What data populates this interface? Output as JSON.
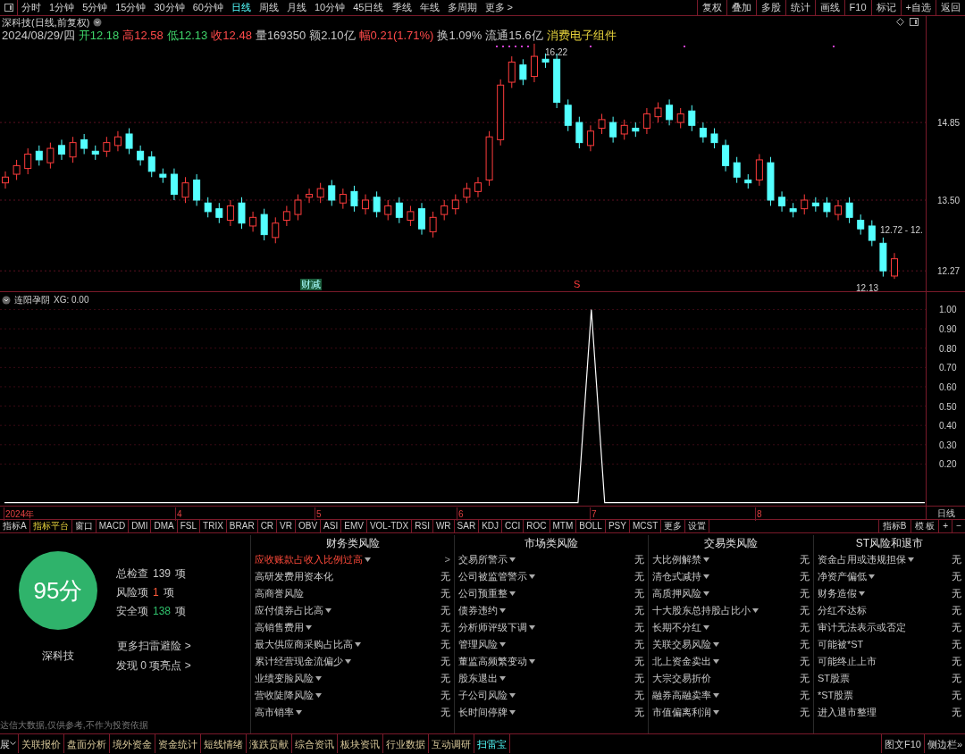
{
  "toolbar": {
    "periods": [
      {
        "label": "分时",
        "selected": false
      },
      {
        "label": "1分钟",
        "selected": false
      },
      {
        "label": "5分钟",
        "selected": false
      },
      {
        "label": "15分钟",
        "selected": false
      },
      {
        "label": "30分钟",
        "selected": false
      },
      {
        "label": "60分钟",
        "selected": false
      },
      {
        "label": "日线",
        "selected": true
      },
      {
        "label": "周线",
        "selected": false
      },
      {
        "label": "月线",
        "selected": false
      },
      {
        "label": "10分钟",
        "selected": false
      },
      {
        "label": "45日线",
        "selected": false
      },
      {
        "label": "季线",
        "selected": false
      },
      {
        "label": "年线",
        "selected": false
      },
      {
        "label": "多周期",
        "selected": false
      },
      {
        "label": "更多 >",
        "selected": false
      }
    ],
    "actions": [
      "复权",
      "叠加",
      "多股",
      "统计",
      "画线",
      "F10",
      "标记",
      "+自选",
      "返回"
    ]
  },
  "quote": {
    "title": "深科技(日线,前复权)",
    "date": "2024/08/29/四",
    "fields": [
      {
        "text": "开12.18",
        "color": "#3fd46a"
      },
      {
        "text": "高12.58",
        "color": "#ff4a4a"
      },
      {
        "text": "低12.13",
        "color": "#3fd46a"
      },
      {
        "text": "收12.48",
        "color": "#ff4a4a"
      },
      {
        "text": "量169350",
        "color": "#c8c8c8"
      },
      {
        "text": "额2.10亿",
        "color": "#c8c8c8"
      },
      {
        "text": "幅0.21(1.71%)",
        "color": "#ff4a4a"
      },
      {
        "text": "换1.09%",
        "color": "#c8c8c8"
      },
      {
        "text": "流通15.6亿",
        "color": "#c8c8c8"
      },
      {
        "text": "消费电子组件",
        "color": "#e6d23c"
      }
    ]
  },
  "price_chart": {
    "high_label": "16.22",
    "range_label": "12.72 - 12.",
    "low_label": "12.13",
    "markers": [
      {
        "text": "财减",
        "kind": "box"
      },
      {
        "text": "S",
        "kind": "signal"
      }
    ],
    "chart_data": {
      "type": "candlestick",
      "grid": true,
      "ylim": [
        11.9,
        16.7
      ],
      "yticks": [
        {
          "value": 14.85,
          "label": "14.85"
        },
        {
          "value": 13.5,
          "label": "13.50"
        },
        {
          "value": 12.27,
          "label": "12.27"
        }
      ],
      "ohlc": [
        [
          13.8,
          14.0,
          13.7,
          13.9
        ],
        [
          13.95,
          14.2,
          13.85,
          14.1
        ],
        [
          14.05,
          14.4,
          13.95,
          14.3
        ],
        [
          14.35,
          14.45,
          14.1,
          14.2
        ],
        [
          14.15,
          14.5,
          14.05,
          14.4
        ],
        [
          14.45,
          14.55,
          14.2,
          14.3
        ],
        [
          14.25,
          14.6,
          14.15,
          14.5
        ],
        [
          14.55,
          14.65,
          14.3,
          14.4
        ],
        [
          14.35,
          14.45,
          14.2,
          14.3
        ],
        [
          14.35,
          14.6,
          14.25,
          14.5
        ],
        [
          14.45,
          14.7,
          14.35,
          14.6
        ],
        [
          14.65,
          14.75,
          14.3,
          14.4
        ],
        [
          14.35,
          14.45,
          14.1,
          14.2
        ],
        [
          14.25,
          14.35,
          13.9,
          14.0
        ],
        [
          13.95,
          14.05,
          13.8,
          13.9
        ],
        [
          13.95,
          14.05,
          13.5,
          13.6
        ],
        [
          13.55,
          13.9,
          13.45,
          13.8
        ],
        [
          13.85,
          13.95,
          13.4,
          13.5
        ],
        [
          13.45,
          13.55,
          13.2,
          13.3
        ],
        [
          13.35,
          13.45,
          13.1,
          13.2
        ],
        [
          13.15,
          13.5,
          13.05,
          13.4
        ],
        [
          13.45,
          13.55,
          13.0,
          13.1
        ],
        [
          13.05,
          13.3,
          12.95,
          13.2
        ],
        [
          13.25,
          13.35,
          12.8,
          12.9
        ],
        [
          12.85,
          13.2,
          12.75,
          13.1
        ],
        [
          13.15,
          13.4,
          13.05,
          13.3
        ],
        [
          13.25,
          13.6,
          13.15,
          13.5
        ],
        [
          13.55,
          13.7,
          13.45,
          13.6
        ],
        [
          13.55,
          13.8,
          13.45,
          13.7
        ],
        [
          13.75,
          13.85,
          13.4,
          13.5
        ],
        [
          13.45,
          13.7,
          13.35,
          13.6
        ],
        [
          13.65,
          13.75,
          13.3,
          13.4
        ],
        [
          13.35,
          13.6,
          13.25,
          13.5
        ],
        [
          13.55,
          13.65,
          13.2,
          13.3
        ],
        [
          13.25,
          13.5,
          13.15,
          13.4
        ],
        [
          13.45,
          13.55,
          13.1,
          13.2
        ],
        [
          13.15,
          13.4,
          13.05,
          13.3
        ],
        [
          13.35,
          13.45,
          12.9,
          13.0
        ],
        [
          12.95,
          13.3,
          12.85,
          13.2
        ],
        [
          13.25,
          13.5,
          13.15,
          13.4
        ],
        [
          13.35,
          13.6,
          13.25,
          13.5
        ],
        [
          13.55,
          13.8,
          13.45,
          13.7
        ],
        [
          13.65,
          13.9,
          13.55,
          13.8
        ],
        [
          13.85,
          14.7,
          13.75,
          14.6
        ],
        [
          14.55,
          15.6,
          14.45,
          15.5
        ],
        [
          15.55,
          16.0,
          15.45,
          15.9
        ],
        [
          15.85,
          15.95,
          15.5,
          15.6
        ],
        [
          15.65,
          16.22,
          15.55,
          16.0
        ],
        [
          15.95,
          16.05,
          15.8,
          15.9
        ],
        [
          15.95,
          16.05,
          15.1,
          15.2
        ],
        [
          15.15,
          15.25,
          14.7,
          14.8
        ],
        [
          14.85,
          14.95,
          14.4,
          14.5
        ],
        [
          14.45,
          14.8,
          14.35,
          14.7
        ],
        [
          14.75,
          15.0,
          14.65,
          14.9
        ],
        [
          14.85,
          14.95,
          14.5,
          14.6
        ],
        [
          14.65,
          14.9,
          14.55,
          14.8
        ],
        [
          14.75,
          14.85,
          14.6,
          14.7
        ],
        [
          14.75,
          15.1,
          14.65,
          15.0
        ],
        [
          14.95,
          15.2,
          14.85,
          15.1
        ],
        [
          15.15,
          15.25,
          14.8,
          14.9
        ],
        [
          14.85,
          15.1,
          14.75,
          15.0
        ],
        [
          15.05,
          15.15,
          14.7,
          14.8
        ],
        [
          14.75,
          14.85,
          14.5,
          14.6
        ],
        [
          14.65,
          14.75,
          14.4,
          14.5
        ],
        [
          14.45,
          14.55,
          14.0,
          14.1
        ],
        [
          14.15,
          14.25,
          13.8,
          13.9
        ],
        [
          13.85,
          13.95,
          13.7,
          13.8
        ],
        [
          13.85,
          14.3,
          13.75,
          14.2
        ],
        [
          14.15,
          14.25,
          13.4,
          13.5
        ],
        [
          13.55,
          13.65,
          13.3,
          13.4
        ],
        [
          13.35,
          13.45,
          13.2,
          13.3
        ],
        [
          13.35,
          13.6,
          13.25,
          13.5
        ],
        [
          13.45,
          13.55,
          13.3,
          13.4
        ],
        [
          13.45,
          13.55,
          13.2,
          13.3
        ],
        [
          13.25,
          13.5,
          13.15,
          13.4
        ],
        [
          13.45,
          13.55,
          13.1,
          13.2
        ],
        [
          13.15,
          13.25,
          12.9,
          13.0
        ],
        [
          13.05,
          13.15,
          12.7,
          12.8
        ],
        [
          12.75,
          12.85,
          12.17,
          12.27
        ],
        [
          12.18,
          12.58,
          12.13,
          12.48
        ]
      ]
    }
  },
  "indicator": {
    "title": "连阳孕阴",
    "reading": "XG: 0.00",
    "chart_data": {
      "type": "line",
      "grid": true,
      "ylim": [
        -0.02,
        1.09
      ],
      "yticks": [
        {
          "value": 1,
          "label": "1.00"
        },
        {
          "value": 0.9,
          "label": "0.90"
        },
        {
          "value": 0.8,
          "label": "0.80"
        },
        {
          "value": 0.7,
          "label": "0.70"
        },
        {
          "value": 0.6,
          "label": "0.60"
        },
        {
          "value": 0.5,
          "label": "0.50"
        },
        {
          "value": 0.4,
          "label": "0.40"
        },
        {
          "value": 0.3,
          "label": "0.30"
        },
        {
          "value": 0.2,
          "label": "0.20"
        }
      ],
      "series": [
        {
          "color": "#ffffff",
          "values": [
            0,
            0,
            0,
            0,
            0,
            0,
            0,
            0,
            0,
            0,
            0,
            0,
            0,
            0,
            0,
            0,
            0,
            0,
            0,
            0,
            0,
            0,
            0,
            0,
            0,
            0,
            0,
            0,
            0,
            0,
            0,
            0,
            0,
            0,
            0,
            0,
            0,
            0,
            0,
            0,
            0,
            0,
            0,
            0,
            1,
            0,
            0,
            0,
            0,
            0,
            0,
            0,
            0,
            0,
            0,
            0,
            0,
            0,
            0,
            0,
            0,
            0,
            0,
            0,
            0,
            0,
            0,
            0,
            0,
            0
          ]
        }
      ]
    }
  },
  "time_axis": {
    "labels": [
      "2024年",
      "4",
      "5",
      "6",
      "7",
      "8"
    ],
    "period": "日线"
  },
  "indicator_tabs": {
    "items": [
      {
        "label": "指标A",
        "selected": false
      },
      {
        "label": "指标平台",
        "selected": true
      },
      {
        "label": "窗口",
        "selected": false
      },
      {
        "label": "MACD",
        "selected": false
      },
      {
        "label": "DMI",
        "selected": false
      },
      {
        "label": "DMA",
        "selected": false
      },
      {
        "label": "FSL",
        "selected": false
      },
      {
        "label": "TRIX",
        "selected": false
      },
      {
        "label": "BRAR",
        "selected": false
      },
      {
        "label": "CR",
        "selected": false
      },
      {
        "label": "VR",
        "selected": false
      },
      {
        "label": "OBV",
        "selected": false
      },
      {
        "label": "ASI",
        "selected": false
      },
      {
        "label": "EMV",
        "selected": false
      },
      {
        "label": "VOL-TDX",
        "selected": false
      },
      {
        "label": "RSI",
        "selected": false
      },
      {
        "label": "WR",
        "selected": false
      },
      {
        "label": "SAR",
        "selected": false
      },
      {
        "label": "KDJ",
        "selected": false
      },
      {
        "label": "CCI",
        "selected": false
      },
      {
        "label": "ROC",
        "selected": false
      },
      {
        "label": "MTM",
        "selected": false
      },
      {
        "label": "BOLL",
        "selected": false
      },
      {
        "label": "PSY",
        "selected": false
      },
      {
        "label": "MCST",
        "selected": false
      },
      {
        "label": "更多",
        "selected": false
      },
      {
        "label": "设置",
        "selected": false
      }
    ],
    "right": [
      "指标B",
      "模 板",
      "+",
      "−"
    ]
  },
  "risk_scan": {
    "score": "95分",
    "stock": "深科技",
    "stats": [
      {
        "label": "总检查",
        "value": "139",
        "unit": "项",
        "color": "#c8c8c8"
      },
      {
        "label": "风险项",
        "value": "1",
        "unit": "项",
        "color": "#ff5a3a"
      },
      {
        "label": "安全项",
        "value": "138",
        "unit": "项",
        "color": "#2fc06b"
      }
    ],
    "links": [
      "更多扫雷避险 >",
      "发现 0 项亮点 >"
    ],
    "disclaimer": "达信大数据,仅供参考,不作为投资依据",
    "columns": [
      {
        "title": "财务类风险",
        "items": [
          {
            "label": "应收账款占收入比例过高",
            "result": ">",
            "flagged": true,
            "dropdown": true
          },
          {
            "label": "高研发费用资本化",
            "result": "无",
            "flagged": false,
            "dropdown": false
          },
          {
            "label": "高商誉风险",
            "result": "无",
            "flagged": false,
            "dropdown": false
          },
          {
            "label": "应付债券占比高",
            "result": "无",
            "flagged": false,
            "dropdown": true
          },
          {
            "label": "高销售费用",
            "result": "无",
            "flagged": false,
            "dropdown": true
          },
          {
            "label": "最大供应商采购占比高",
            "result": "无",
            "flagged": false,
            "dropdown": true
          },
          {
            "label": "累计经营现金流偏少",
            "result": "无",
            "flagged": false,
            "dropdown": true
          },
          {
            "label": "业绩变脸风险",
            "result": "无",
            "flagged": false,
            "dropdown": true
          },
          {
            "label": "营收陡降风险",
            "result": "无",
            "flagged": false,
            "dropdown": true
          },
          {
            "label": "高市销率",
            "result": "无",
            "flagged": false,
            "dropdown": true
          }
        ]
      },
      {
        "title": "市场类风险",
        "items": [
          {
            "label": "交易所警示",
            "result": "无",
            "flagged": false,
            "dropdown": true
          },
          {
            "label": "公司被监管警示",
            "result": "无",
            "flagged": false,
            "dropdown": true
          },
          {
            "label": "公司预重整",
            "result": "无",
            "flagged": false,
            "dropdown": true
          },
          {
            "label": "债券违约",
            "result": "无",
            "flagged": false,
            "dropdown": true
          },
          {
            "label": "分析师评级下调",
            "result": "无",
            "flagged": false,
            "dropdown": true
          },
          {
            "label": "管理风险",
            "result": "无",
            "flagged": false,
            "dropdown": true
          },
          {
            "label": "董监高频繁变动",
            "result": "无",
            "flagged": false,
            "dropdown": true
          },
          {
            "label": "股东退出",
            "result": "无",
            "flagged": false,
            "dropdown": true
          },
          {
            "label": "子公司风险",
            "result": "无",
            "flagged": false,
            "dropdown": true
          },
          {
            "label": "长时间停牌",
            "result": "无",
            "flagged": false,
            "dropdown": true
          }
        ]
      },
      {
        "title": "交易类风险",
        "items": [
          {
            "label": "大比例解禁",
            "result": "无",
            "flagged": false,
            "dropdown": true
          },
          {
            "label": "清仓式减持",
            "result": "无",
            "flagged": false,
            "dropdown": true
          },
          {
            "label": "高质押风险",
            "result": "无",
            "flagged": false,
            "dropdown": true
          },
          {
            "label": "十大股东总持股占比小",
            "result": "无",
            "flagged": false,
            "dropdown": true
          },
          {
            "label": "长期不分红",
            "result": "无",
            "flagged": false,
            "dropdown": true
          },
          {
            "label": "关联交易风险",
            "result": "无",
            "flagged": false,
            "dropdown": true
          },
          {
            "label": "北上资金卖出",
            "result": "无",
            "flagged": false,
            "dropdown": true
          },
          {
            "label": "大宗交易折价",
            "result": "无",
            "flagged": false,
            "dropdown": false
          },
          {
            "label": "融券高融卖率",
            "result": "无",
            "flagged": false,
            "dropdown": true
          },
          {
            "label": "市值偏离利润",
            "result": "无",
            "flagged": false,
            "dropdown": true
          }
        ]
      },
      {
        "title": "ST风险和退市",
        "items": [
          {
            "label": "资金占用或违规担保",
            "result": "无",
            "flagged": false,
            "dropdown": true
          },
          {
            "label": "净资产偏低",
            "result": "无",
            "flagged": false,
            "dropdown": true
          },
          {
            "label": "财务造假",
            "result": "无",
            "flagged": false,
            "dropdown": true
          },
          {
            "label": "分红不达标",
            "result": "无",
            "flagged": false,
            "dropdown": false
          },
          {
            "label": "审计无法表示或否定",
            "result": "无",
            "flagged": false,
            "dropdown": false
          },
          {
            "label": "可能被*ST",
            "result": "无",
            "flagged": false,
            "dropdown": false
          },
          {
            "label": "可能终止上市",
            "result": "无",
            "flagged": false,
            "dropdown": false
          },
          {
            "label": "ST股票",
            "result": "无",
            "flagged": false,
            "dropdown": false
          },
          {
            "label": "*ST股票",
            "result": "无",
            "flagged": false,
            "dropdown": false
          },
          {
            "label": "进入退市整理",
            "result": "无",
            "flagged": false,
            "dropdown": false
          }
        ]
      }
    ]
  },
  "bottom_bar": {
    "expand": "展",
    "tabs": [
      {
        "label": "关联报价",
        "selected": false
      },
      {
        "label": "盘面分析",
        "selected": false
      },
      {
        "label": "境外资金",
        "selected": false
      },
      {
        "label": "资金统计",
        "selected": false
      },
      {
        "label": "短线情绪",
        "selected": false
      },
      {
        "label": "涨跌贡献",
        "selected": false
      },
      {
        "label": "综合资讯",
        "selected": false
      },
      {
        "label": "板块资讯",
        "selected": false
      },
      {
        "label": "行业数据",
        "selected": false
      },
      {
        "label": "互动调研",
        "selected": false
      },
      {
        "label": "扫雷宝",
        "selected": true
      }
    ],
    "right": [
      "图文F10",
      "侧边栏»"
    ]
  }
}
